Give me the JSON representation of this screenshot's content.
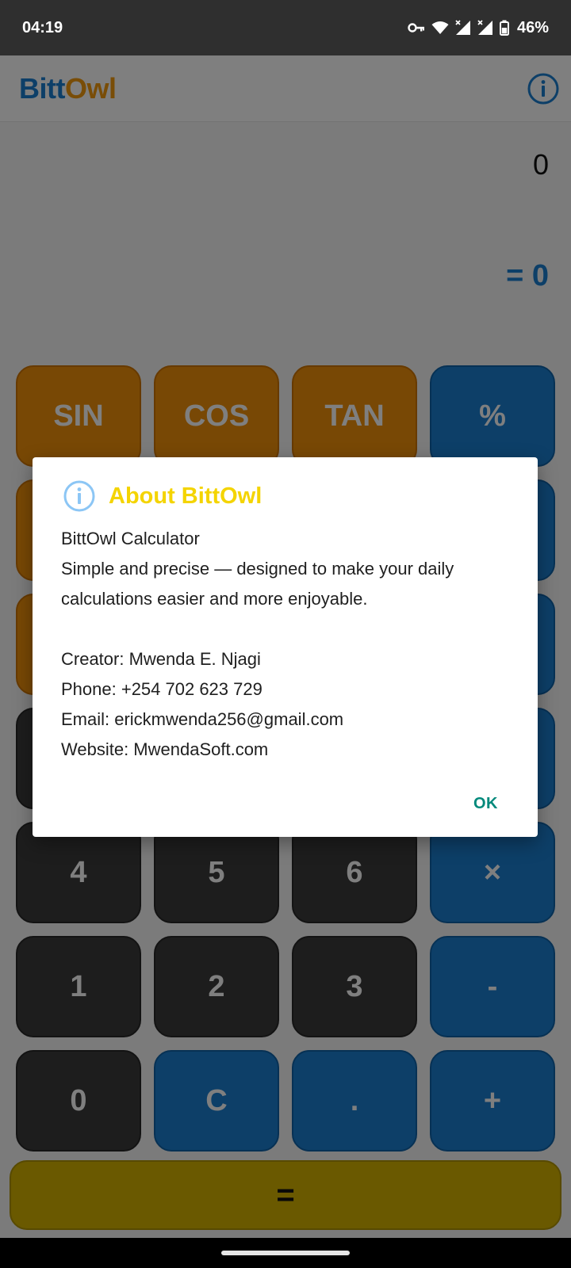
{
  "status_bar": {
    "time": "04:19",
    "battery": "46%"
  },
  "app_bar": {
    "logo_part1": "Bitt",
    "logo_part2": "Owl"
  },
  "display": {
    "expression": "0",
    "result": "= 0"
  },
  "keys": {
    "sin": "SIN",
    "cos": "COS",
    "tan": "TAN",
    "percent": "%",
    "four": "4",
    "five": "5",
    "six": "6",
    "multiply": "×",
    "one": "1",
    "two": "2",
    "three": "3",
    "minus": "-",
    "zero": "0",
    "clear": "C",
    "dot": ".",
    "plus": "+",
    "equals": "="
  },
  "dialog": {
    "title": "About BittOwl",
    "line_app": "BittOwl Calculator",
    "line_desc1": "Simple and precise — designed to make your daily",
    "line_desc2": "calculations easier and more enjoyable.",
    "line_creator": "Creator: Mwenda E. Njagi",
    "line_phone": "Phone: +254 702 623 729",
    "line_email": "Email: erickmwenda256@gmail.com",
    "line_website": "Website: MwendaSoft.com",
    "ok_label": "OK"
  },
  "colors": {
    "accent_blue": "#1a7fd1",
    "accent_orange": "#f29a0e",
    "dialog_title": "#f4d400",
    "ok_button": "#00897b"
  }
}
